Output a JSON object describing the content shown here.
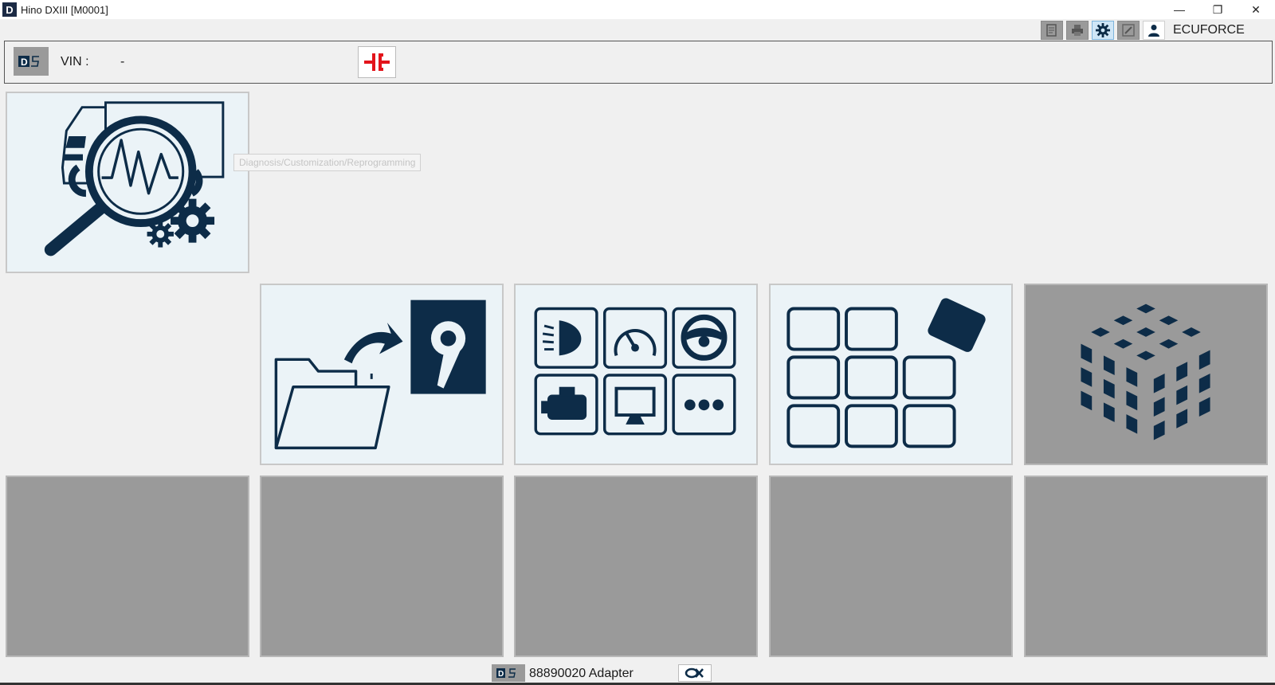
{
  "window": {
    "app_icon_letter": "D",
    "title": "Hino DXIII [M0001]",
    "controls": {
      "minimize": "—",
      "restore": "❐",
      "close": "✕"
    }
  },
  "toolbar": {
    "icons": [
      "report-icon",
      "print-icon",
      "settings-gear-icon",
      "edit-icon",
      "user-icon"
    ],
    "active_icon": "settings-gear-icon",
    "username": "ECUFORCE"
  },
  "vin_bar": {
    "label": "VIN :",
    "value": "-"
  },
  "tooltip": {
    "text": "Diagnosis/Customization/Reprogramming"
  },
  "tiles": {
    "row1": [
      {
        "name": "diagnosis-tile",
        "icon": "truck-magnifier-gears-icon",
        "enabled": true
      }
    ],
    "row2": [
      {
        "name": "file-management-tile",
        "icon": "folder-to-storage-icon",
        "enabled": true
      },
      {
        "name": "vehicle-functions-tile",
        "icon": "function-grid-icon",
        "enabled": true
      },
      {
        "name": "app-grid-tile",
        "icon": "tile-grid-icon",
        "enabled": true
      },
      {
        "name": "cube-tile",
        "icon": "cube-icon",
        "enabled": false
      }
    ],
    "row3_disabled_count": 5
  },
  "status_bar": {
    "adapter_label": "88890020 Adapter"
  },
  "colors": {
    "icon_navy": "#0d2c48",
    "tile_light": "#ebf3f7",
    "tile_disabled": "#9a9a9a",
    "connector_red": "#e3141b",
    "active_tool": "#cfe6f7"
  }
}
